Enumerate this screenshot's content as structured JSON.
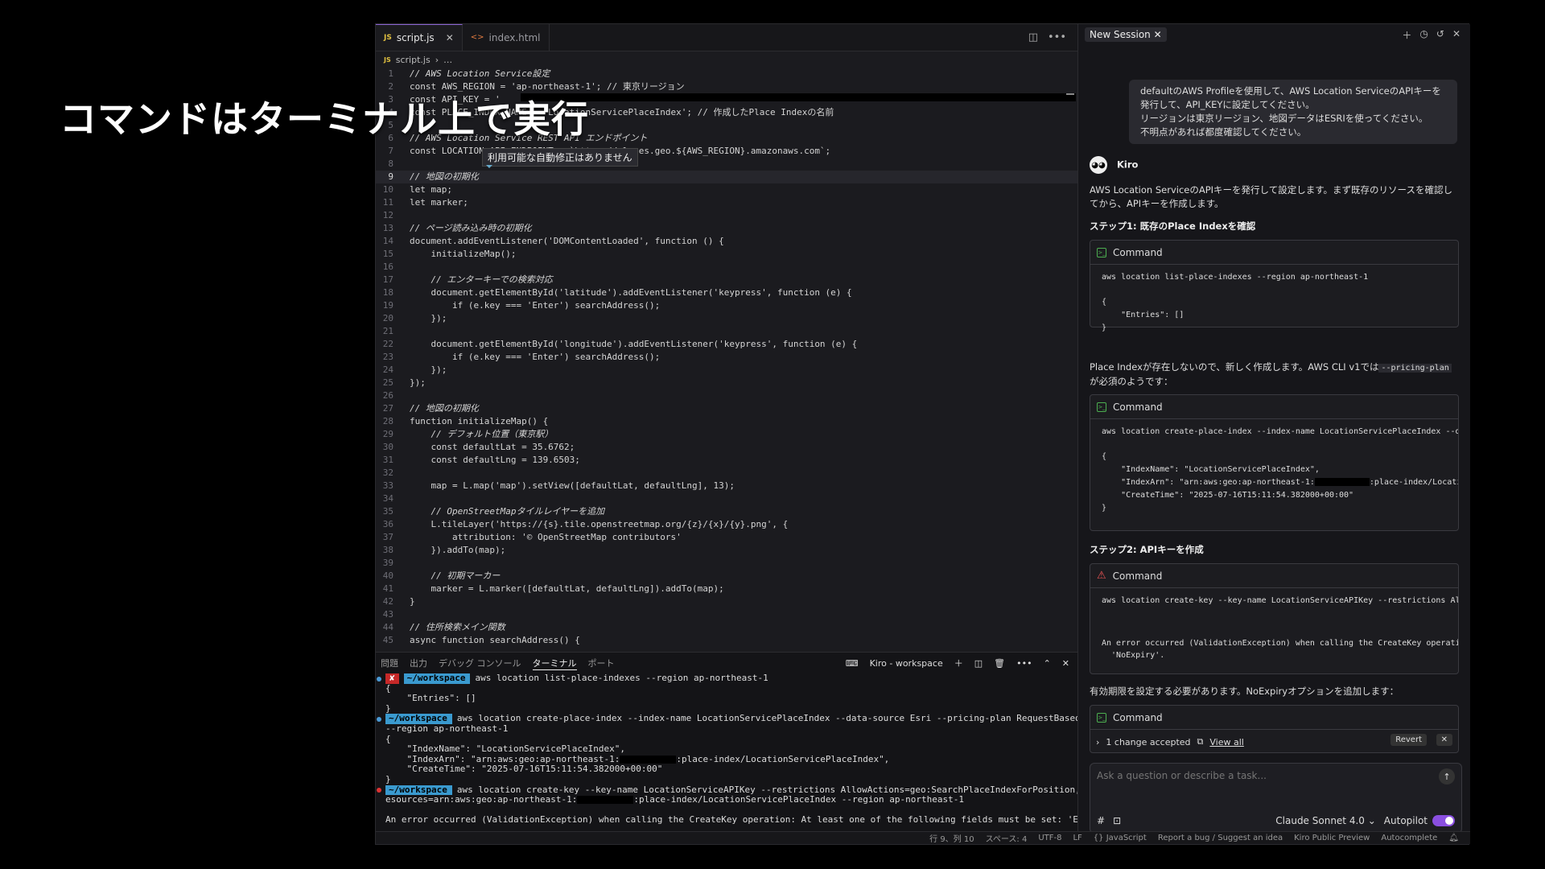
{
  "overlay": {
    "title": "コマンドはターミナル上で実行"
  },
  "editor": {
    "tabs": [
      {
        "label": "script.js",
        "active": true
      },
      {
        "label": "index.html",
        "active": false
      }
    ],
    "breadcrumb": {
      "file": "script.js",
      "rest": "…"
    },
    "tooltip": "利用可能な自動修正はありません",
    "lines": [
      {
        "n": "1",
        "t": "// AWS Location Service設定"
      },
      {
        "n": "2",
        "t": "const AWS_REGION = 'ap-northeast-1'; // 東京リージョン"
      },
      {
        "n": "3",
        "t": "const API_KEY = '"
      },
      {
        "n": "4",
        "t": "const PLACE_INDEX_NAME = 'LocationServicePlaceIndex'; // 作成したPlace Indexの名前"
      },
      {
        "n": "5",
        "t": ""
      },
      {
        "n": "6",
        "t": "// AWS Location Service REST API エンドポイント"
      },
      {
        "n": "7",
        "t": "const LOCATION_API_ENDPOINT = `https://places.geo.${AWS_REGION}.amazonaws.com`;"
      },
      {
        "n": "8",
        "t": ""
      },
      {
        "n": "9",
        "t": "// 地図の初期化"
      },
      {
        "n": "10",
        "t": "let map;"
      },
      {
        "n": "11",
        "t": "let marker;"
      },
      {
        "n": "12",
        "t": ""
      },
      {
        "n": "13",
        "t": "// ページ読み込み時の初期化"
      },
      {
        "n": "14",
        "t": "document.addEventListener('DOMContentLoaded', function () {"
      },
      {
        "n": "15",
        "t": "    initializeMap();"
      },
      {
        "n": "16",
        "t": ""
      },
      {
        "n": "17",
        "t": "    // エンターキーでの検索対応"
      },
      {
        "n": "18",
        "t": "    document.getElementById('latitude').addEventListener('keypress', function (e) {"
      },
      {
        "n": "19",
        "t": "        if (e.key === 'Enter') searchAddress();"
      },
      {
        "n": "20",
        "t": "    });"
      },
      {
        "n": "21",
        "t": ""
      },
      {
        "n": "22",
        "t": "    document.getElementById('longitude').addEventListener('keypress', function (e) {"
      },
      {
        "n": "23",
        "t": "        if (e.key === 'Enter') searchAddress();"
      },
      {
        "n": "24",
        "t": "    });"
      },
      {
        "n": "25",
        "t": "});"
      },
      {
        "n": "26",
        "t": ""
      },
      {
        "n": "27",
        "t": "// 地図の初期化"
      },
      {
        "n": "28",
        "t": "function initializeMap() {"
      },
      {
        "n": "29",
        "t": "    // デフォルト位置（東京駅）"
      },
      {
        "n": "30",
        "t": "    const defaultLat = 35.6762;"
      },
      {
        "n": "31",
        "t": "    const defaultLng = 139.6503;"
      },
      {
        "n": "32",
        "t": ""
      },
      {
        "n": "33",
        "t": "    map = L.map('map').setView([defaultLat, defaultLng], 13);"
      },
      {
        "n": "34",
        "t": ""
      },
      {
        "n": "35",
        "t": "    // OpenStreetMapタイルレイヤーを追加"
      },
      {
        "n": "36",
        "t": "    L.tileLayer('https://{s}.tile.openstreetmap.org/{z}/{x}/{y}.png', {"
      },
      {
        "n": "37",
        "t": "        attribution: '© OpenStreetMap contributors'"
      },
      {
        "n": "38",
        "t": "    }).addTo(map);"
      },
      {
        "n": "39",
        "t": ""
      },
      {
        "n": "40",
        "t": "    // 初期マーカー"
      },
      {
        "n": "41",
        "t": "    marker = L.marker([defaultLat, defaultLng]).addTo(map);"
      },
      {
        "n": "42",
        "t": "}"
      },
      {
        "n": "43",
        "t": ""
      },
      {
        "n": "44",
        "t": "// 住所検索メイン関数"
      },
      {
        "n": "45",
        "t": "async function searchAddress() {"
      }
    ]
  },
  "panel": {
    "tabs": [
      "問題",
      "出力",
      "デバッグ コンソール",
      "ターミナル",
      "ポート"
    ],
    "active_tab": "ターミナル",
    "session": "Kiro - workspace",
    "terminal": {
      "prompt": "~/workspace",
      "err_mark": "✘",
      "cmd1": "aws location list-place-indexes --region ap-northeast-1",
      "out1": [
        "{",
        "    \"Entries\": []",
        "}"
      ],
      "cmd2": "aws location create-place-index --index-name LocationServicePlaceIndex --data-source Esri --pricing-plan RequestBasedUsage",
      "cmd2b": "--region ap-northeast-1",
      "out2": [
        "{",
        "    \"IndexName\": \"LocationServicePlaceIndex\",",
        "    \"IndexArn\": \"arn:aws:geo:ap-northeast-1:",
        ":place-index/LocationServicePlaceIndex\",",
        "    \"CreateTime\": \"2025-07-16T15:11:54.382000+00:00\"",
        "}"
      ],
      "cmd3": "aws location create-key --key-name LocationServiceAPIKey --restrictions AllowActions=geo:SearchPlaceIndexForPosition,AllowR",
      "cmd3b": "esources=arn:aws:geo:ap-northeast-1:",
      "cmd3c": ":place-index/LocationServicePlaceIndex --region ap-northeast-1",
      "err": "An error occurred (ValidationException) when calling the CreateKey operation: At least one of the following fields must be set: 'ExpireTime',"
    }
  },
  "statusbar": [
    "行 9、列 10",
    "スペース: 4",
    "UTF-8",
    "LF",
    "{} JavaScript",
    "Report a bug / Suggest an idea",
    "Kiro Public Preview",
    "Autocomplete"
  ],
  "chat": {
    "tab": "New Session",
    "user_message": [
      "defaultのAWS Profileを使用して、AWS Location ServiceのAPIキーを発行して、API_KEYに設定してください。",
      "リージョンは東京リージョン、地図データはESRIを使ってください。",
      "不明点があれば都度確認してください。"
    ],
    "agent_name": "Kiro",
    "agent_intro": "AWS Location ServiceのAPIキーを発行して設定します。まず既存のリソースを確認してから、APIキーを作成します。",
    "step1": "ステップ1: 既存のPlace Indexを確認",
    "cmd_label": "Command",
    "cmd1": "aws location list-place-indexes --region ap-northeast-1",
    "cmd1_out": [
      "{",
      "    \"Entries\": []",
      "}"
    ],
    "note1_a": "Place Indexが存在しないので、新しく作成します。AWS CLI v1では",
    "note1_code": "--pricing-plan",
    "note1_b": "が必須のようです：",
    "cmd2": "aws location create-place-index --index-name LocationServicePlaceIndex --da",
    "cmd2_out": [
      "{",
      "    \"IndexName\": \"LocationServicePlaceIndex\",",
      "    \"IndexArn\": \"arn:aws:geo:ap-northeast-1:",
      ":place-index/Locati",
      "    \"CreateTime\": \"2025-07-16T15:11:54.382000+00:00\"",
      "}"
    ],
    "step2": "ステップ2: APIキーを作成",
    "cmd3": "aws location create-key --key-name LocationServiceAPIKey --restrictions All",
    "cmd3_out": [
      "An error occurred (ValidationException) when calling the CreateKey operatic",
      "  'NoExpiry'."
    ],
    "note2": "有効期限を設定する必要があります。NoExpiryオプションを追加します：",
    "accept_text": "1 change accepted",
    "view_all": "View all",
    "revert": "Revert",
    "ask_placeholder": "Ask a question or describe a task...",
    "model": "Claude Sonnet 4.0",
    "autopilot": "Autopilot"
  }
}
